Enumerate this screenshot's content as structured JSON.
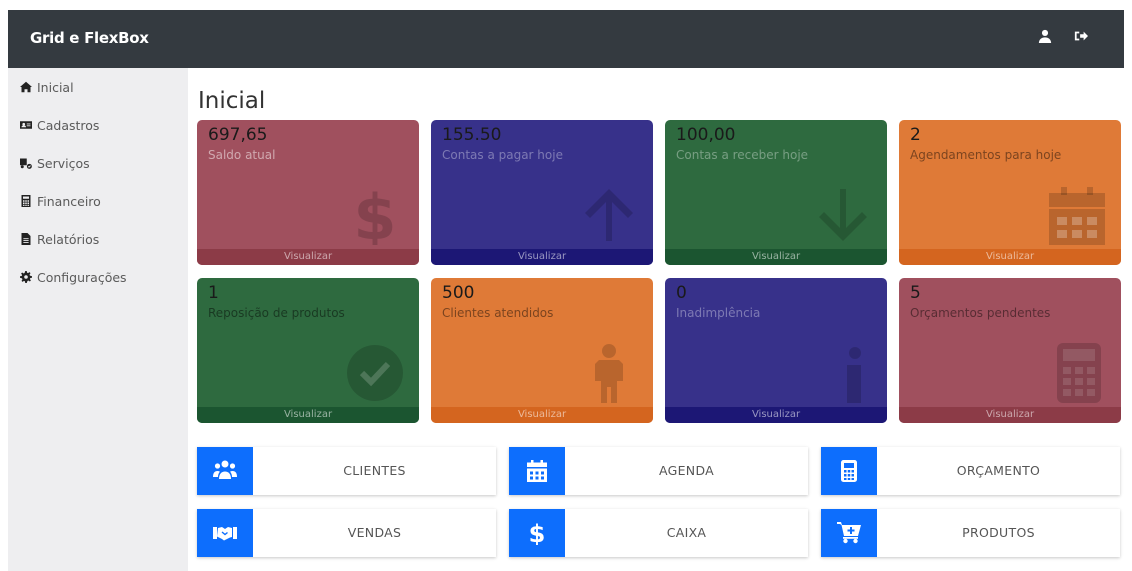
{
  "header": {
    "title": "Grid e FlexBox",
    "icons": [
      "user-icon",
      "sign-out-icon"
    ]
  },
  "sidebar": {
    "items": [
      {
        "label": "Inicial",
        "icon": "home-icon"
      },
      {
        "label": "Cadastros",
        "icon": "id-card-icon"
      },
      {
        "label": "Serviços",
        "icon": "truck-icon"
      },
      {
        "label": "Financeiro",
        "icon": "calculator-icon"
      },
      {
        "label": "Relatórios",
        "icon": "file-icon"
      },
      {
        "label": "Configurações",
        "icon": "gear-icon"
      }
    ]
  },
  "main": {
    "title": "Inicial",
    "cards": [
      {
        "value": "697,65",
        "label": "Saldo atual",
        "footer": "Visualizar",
        "icon": "dollar-icon",
        "color": "#a0505e"
      },
      {
        "value": "155.50",
        "label": "Contas a pagar hoje",
        "footer": "Visualizar",
        "icon": "arrow-up-icon",
        "color": "#37318a"
      },
      {
        "value": "100,00",
        "label": "Contas a receber hoje",
        "footer": "Visualizar",
        "icon": "arrow-down-icon",
        "color": "#2e6a3f"
      },
      {
        "value": "2",
        "label": "Agendamentos para hoje",
        "footer": "Visualizar",
        "icon": "calendar-icon",
        "color": "#df7a37"
      },
      {
        "value": "1",
        "label": "Reposição de produtos",
        "footer": "Visualizar",
        "icon": "check-circle-icon",
        "color": "#2e6a3f"
      },
      {
        "value": "500",
        "label": "Clientes atendidos",
        "footer": "Visualizar",
        "icon": "person-icon",
        "color": "#df7a37"
      },
      {
        "value": "0",
        "label": "Inadimplência",
        "footer": "Visualizar",
        "icon": "info-icon",
        "color": "#37318a"
      },
      {
        "value": "5",
        "label": "Orçamentos pendentes",
        "footer": "Visualizar",
        "icon": "calculator-icon",
        "color": "#a0505e"
      }
    ],
    "shortcuts": [
      {
        "label": "CLIENTES",
        "icon": "users-icon"
      },
      {
        "label": "AGENDA",
        "icon": "calendar-icon"
      },
      {
        "label": "ORÇAMENTO",
        "icon": "calculator-icon"
      },
      {
        "label": "VENDAS",
        "icon": "handshake-icon"
      },
      {
        "label": "CAIXA",
        "icon": "dollar-icon"
      },
      {
        "label": "PRODUTOS",
        "icon": "cart-plus-icon"
      }
    ]
  },
  "colors": {
    "topbar": "#343a40",
    "accent": "#0d6efd"
  }
}
